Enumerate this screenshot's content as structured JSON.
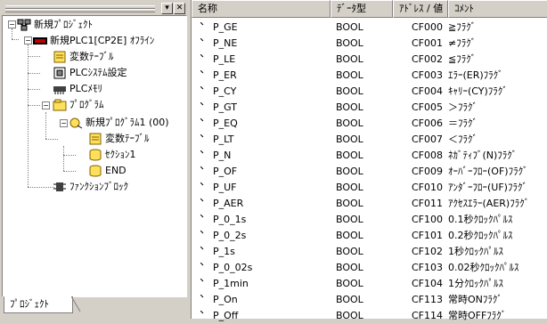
{
  "left_panel": {
    "tab_label": "ﾌﾟﾛｼﾞｪｸﾄ",
    "tree": [
      {
        "id": "root",
        "label": "新規ﾌﾟﾛｼﾞｪｸﾄ",
        "icon": "project-icon"
      },
      {
        "id": "plc",
        "label": "新規PLC1[CP2E] ｵﾌﾗｲﾝ",
        "icon": "plc-icon"
      },
      {
        "id": "vars",
        "label": "変数ﾃｰﾌﾞﾙ",
        "icon": "variable-table-icon"
      },
      {
        "id": "plcsys",
        "label": "PLCｼｽﾃﾑ設定",
        "icon": "settings-icon"
      },
      {
        "id": "plcmem",
        "label": "PLCﾒﾓﾘ",
        "icon": "memory-icon"
      },
      {
        "id": "prog",
        "label": "ﾌﾟﾛｸﾞﾗﾑ",
        "icon": "program-folder-icon"
      },
      {
        "id": "prog1",
        "label": "新規ﾌﾟﾛｸﾞﾗﾑ1 (00)",
        "icon": "program-icon"
      },
      {
        "id": "prog_vars",
        "label": "変数ﾃｰﾌﾞﾙ",
        "icon": "variable-table-icon"
      },
      {
        "id": "section1",
        "label": "ｾｸｼｮﾝ1",
        "icon": "section-icon"
      },
      {
        "id": "end",
        "label": "END",
        "icon": "section-icon"
      },
      {
        "id": "fb",
        "label": "ﾌｧﾝｸｼｮﾝﾌﾞﾛｯｸ",
        "icon": "function-block-icon"
      }
    ]
  },
  "table": {
    "headers": {
      "name": "名称",
      "type": "ﾃﾞｰﾀ型",
      "addr": "ｱﾄﾞﾚｽ / 値",
      "comment": "ｺﾒﾝﾄ"
    },
    "rows": [
      {
        "name": "P_GE",
        "type": "BOOL",
        "addr": "CF000",
        "comment": "≧ﾌﾗｸﾞ"
      },
      {
        "name": "P_NE",
        "type": "BOOL",
        "addr": "CF001",
        "comment": "≠ﾌﾗｸﾞ"
      },
      {
        "name": "P_LE",
        "type": "BOOL",
        "addr": "CF002",
        "comment": "≦ﾌﾗｸﾞ"
      },
      {
        "name": "P_ER",
        "type": "BOOL",
        "addr": "CF003",
        "comment": "ｴﾗｰ(ER)ﾌﾗｸﾞ"
      },
      {
        "name": "P_CY",
        "type": "BOOL",
        "addr": "CF004",
        "comment": "ｷｬﾘｰ(CY)ﾌﾗｸﾞ"
      },
      {
        "name": "P_GT",
        "type": "BOOL",
        "addr": "CF005",
        "comment": "＞ﾌﾗｸﾞ"
      },
      {
        "name": "P_EQ",
        "type": "BOOL",
        "addr": "CF006",
        "comment": "＝ﾌﾗｸﾞ"
      },
      {
        "name": "P_LT",
        "type": "BOOL",
        "addr": "CF007",
        "comment": "＜ﾌﾗｸﾞ"
      },
      {
        "name": "P_N",
        "type": "BOOL",
        "addr": "CF008",
        "comment": "ﾈｶﾞﾃｨﾌﾞ(N)ﾌﾗｸﾞ"
      },
      {
        "name": "P_OF",
        "type": "BOOL",
        "addr": "CF009",
        "comment": "ｵｰﾊﾞｰﾌﾛｰ(OF)ﾌﾗｸﾞ"
      },
      {
        "name": "P_UF",
        "type": "BOOL",
        "addr": "CF010",
        "comment": "ｱﾝﾀﾞｰﾌﾛｰ(UF)ﾌﾗｸﾞ"
      },
      {
        "name": "P_AER",
        "type": "BOOL",
        "addr": "CF011",
        "comment": "ｱｸｾｽｴﾗｰ(AER)ﾌﾗｸﾞ"
      },
      {
        "name": "P_0_1s",
        "type": "BOOL",
        "addr": "CF100",
        "comment": "0.1秒ｸﾛｯｸﾊﾟﾙｽ"
      },
      {
        "name": "P_0_2s",
        "type": "BOOL",
        "addr": "CF101",
        "comment": "0.2秒ｸﾛｯｸﾊﾟﾙｽ"
      },
      {
        "name": "P_1s",
        "type": "BOOL",
        "addr": "CF102",
        "comment": "1秒ｸﾛｯｸﾊﾟﾙｽ"
      },
      {
        "name": "P_0_02s",
        "type": "BOOL",
        "addr": "CF103",
        "comment": "0.02秒ｸﾛｯｸﾊﾟﾙｽ"
      },
      {
        "name": "P_1min",
        "type": "BOOL",
        "addr": "CF104",
        "comment": "1分ｸﾛｯｸﾊﾟﾙｽ"
      },
      {
        "name": "P_On",
        "type": "BOOL",
        "addr": "CF113",
        "comment": "常時ONﾌﾗｸﾞ"
      },
      {
        "name": "P_Off",
        "type": "BOOL",
        "addr": "CF114",
        "comment": "常時OFFﾌﾗｸﾞ"
      }
    ]
  },
  "colors": {
    "background": "#d4d0c8",
    "panel": "#ffffff",
    "border": "#808080"
  }
}
